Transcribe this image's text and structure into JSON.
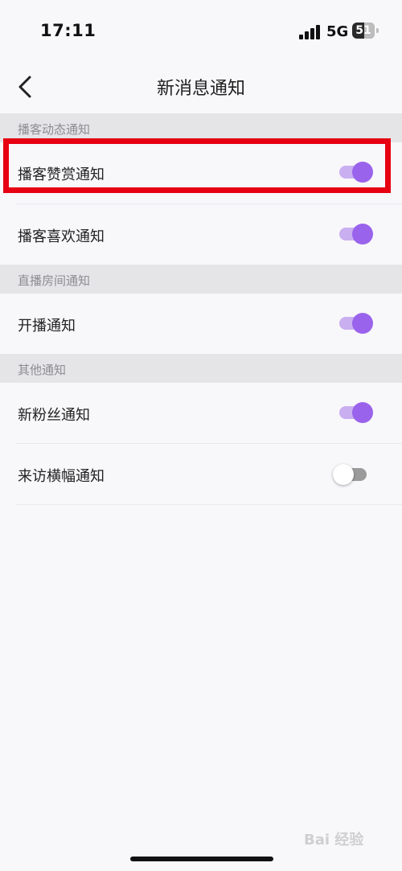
{
  "status_bar": {
    "time": "17:11",
    "network": "5G",
    "battery": "51",
    "signal_icon": "signal-bars-icon",
    "battery_icon": "battery-icon"
  },
  "nav": {
    "back_icon": "chevron-left-icon",
    "title": "新消息通知"
  },
  "sections": [
    {
      "header": "播客动态通知",
      "items": [
        {
          "label": "播客赞赏通知",
          "enabled": true
        },
        {
          "label": "播客喜欢通知",
          "enabled": true
        }
      ]
    },
    {
      "header": "直播房间通知",
      "items": [
        {
          "label": "开播通知",
          "enabled": true
        }
      ]
    },
    {
      "header": "其他通知",
      "items": [
        {
          "label": "新粉丝通知",
          "enabled": true
        },
        {
          "label": "来访横幅通知",
          "enabled": false
        }
      ]
    }
  ],
  "colors": {
    "accent": "#9a63ec",
    "accent_track": "#c9aff0",
    "highlight": "#e60012"
  },
  "watermark": "Bai 经验"
}
